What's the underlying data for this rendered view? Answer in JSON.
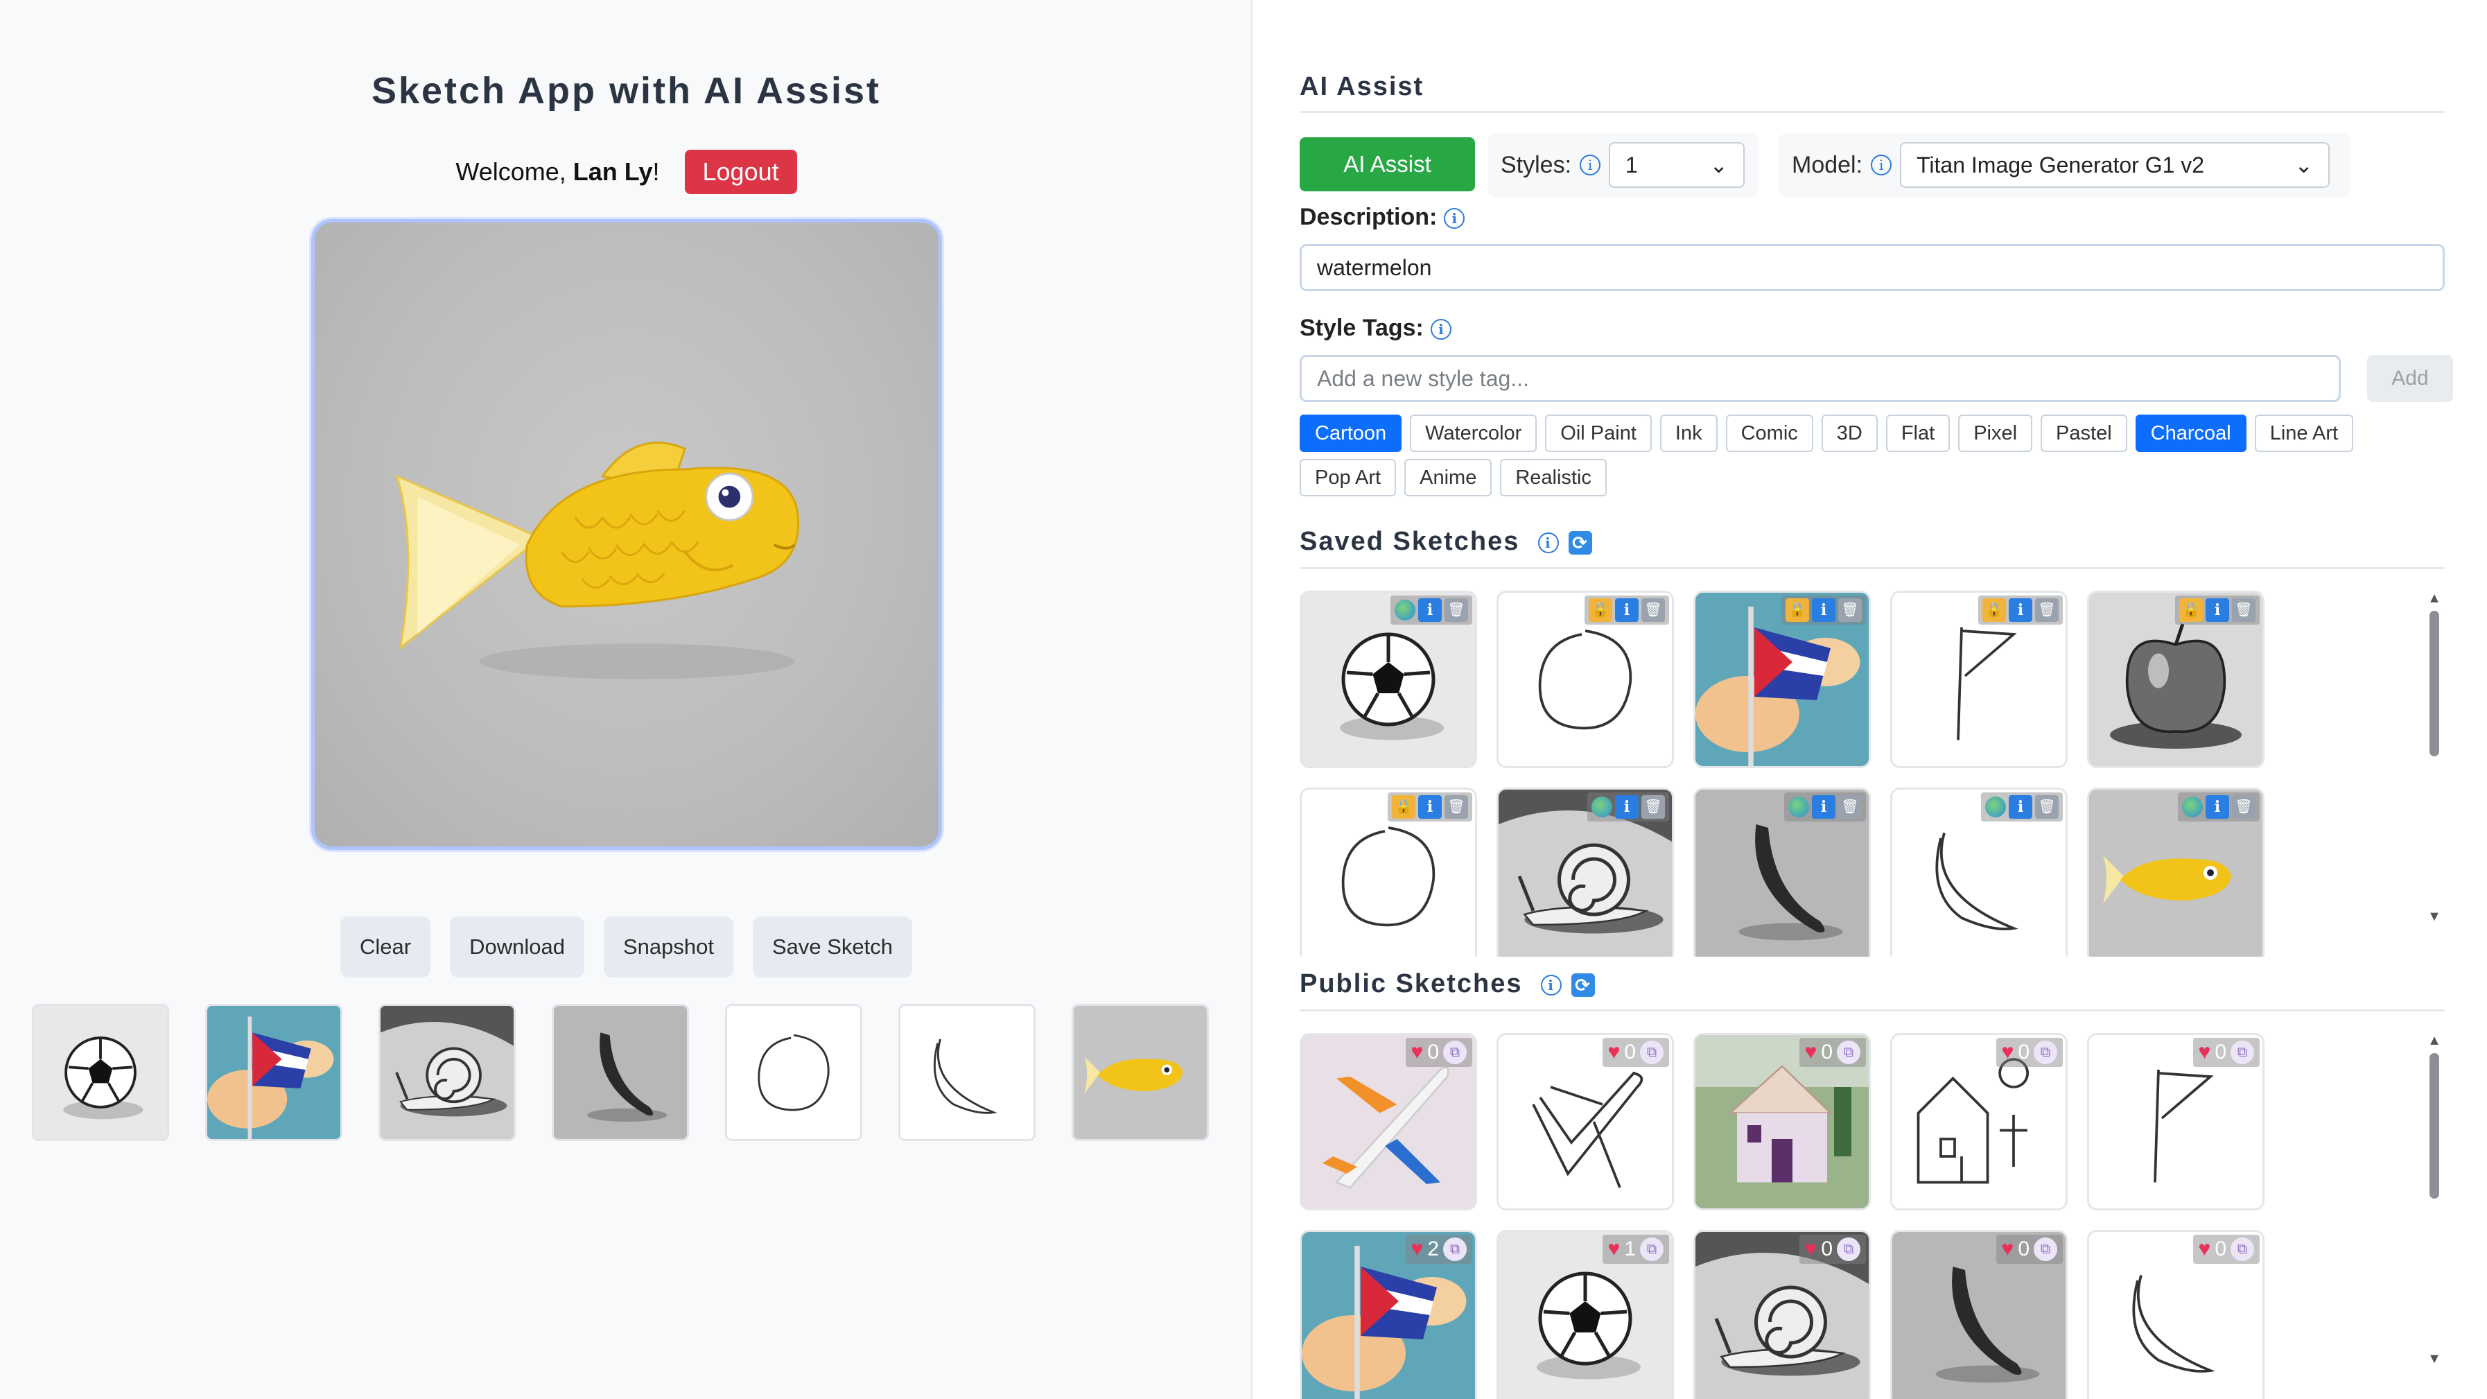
{
  "app": {
    "title": "Sketch App with AI Assist",
    "welcome_prefix": "Welcome,",
    "user_name": "Lan Ly",
    "welcome_suffix": "!",
    "logout_label": "Logout"
  },
  "canvas_actions": {
    "clear_label": "Clear",
    "download_label": "Download",
    "snapshot_label": "Snapshot",
    "save_label": "Save Sketch"
  },
  "recent_strip": [
    "soccer-ball",
    "flag",
    "snail",
    "banana",
    "circle-sketch",
    "banana-sketch",
    "fish"
  ],
  "ai_assist": {
    "section_title": "AI Assist",
    "button_label": "AI Assist",
    "styles_label": "Styles:",
    "styles_value": "1",
    "model_label": "Model:",
    "model_value": "Titan Image Generator G1 v2",
    "description_label": "Description:",
    "description_value": "watermelon",
    "style_tags_label": "Style Tags:",
    "style_tag_placeholder": "Add a new style tag...",
    "add_label": "Add",
    "tags": [
      {
        "label": "Cartoon",
        "selected": true
      },
      {
        "label": "Watercolor",
        "selected": false
      },
      {
        "label": "Oil Paint",
        "selected": false
      },
      {
        "label": "Ink",
        "selected": false
      },
      {
        "label": "Comic",
        "selected": false
      },
      {
        "label": "3D",
        "selected": false
      },
      {
        "label": "Flat",
        "selected": false
      },
      {
        "label": "Pixel",
        "selected": false
      },
      {
        "label": "Pastel",
        "selected": false
      },
      {
        "label": "Charcoal",
        "selected": true
      },
      {
        "label": "Line Art",
        "selected": false
      },
      {
        "label": "Pop Art",
        "selected": false
      },
      {
        "label": "Anime",
        "selected": false
      },
      {
        "label": "Realistic",
        "selected": false
      }
    ]
  },
  "saved_sketches": {
    "title": "Saved Sketches",
    "items": [
      {
        "image": "soccer-ball",
        "visibility": "public"
      },
      {
        "image": "circle-sketch",
        "visibility": "private"
      },
      {
        "image": "flag",
        "visibility": "private"
      },
      {
        "image": "flag-sketch",
        "visibility": "private"
      },
      {
        "image": "apple",
        "visibility": "private"
      },
      {
        "image": "circle-sketch",
        "visibility": "private"
      },
      {
        "image": "snail",
        "visibility": "public"
      },
      {
        "image": "banana",
        "visibility": "public"
      },
      {
        "image": "banana-sketch",
        "visibility": "public"
      },
      {
        "image": "fish",
        "visibility": "public"
      }
    ]
  },
  "public_sketches": {
    "title": "Public Sketches",
    "items": [
      {
        "image": "airplane",
        "likes": "0"
      },
      {
        "image": "airplane-sketch",
        "likes": "0"
      },
      {
        "image": "house",
        "likes": "0"
      },
      {
        "image": "house-sketch",
        "likes": "0"
      },
      {
        "image": "flag-sketch",
        "likes": "0"
      },
      {
        "image": "flag",
        "likes": "2"
      },
      {
        "image": "soccer-ball",
        "likes": "1"
      },
      {
        "image": "snail",
        "likes": "0"
      },
      {
        "image": "banana",
        "likes": "0"
      },
      {
        "image": "banana-sketch",
        "likes": "0"
      }
    ]
  },
  "colors": {
    "accent": "#0d6efd",
    "success": "#28a745",
    "danger": "#dc3545",
    "fish": "#f2c318"
  }
}
